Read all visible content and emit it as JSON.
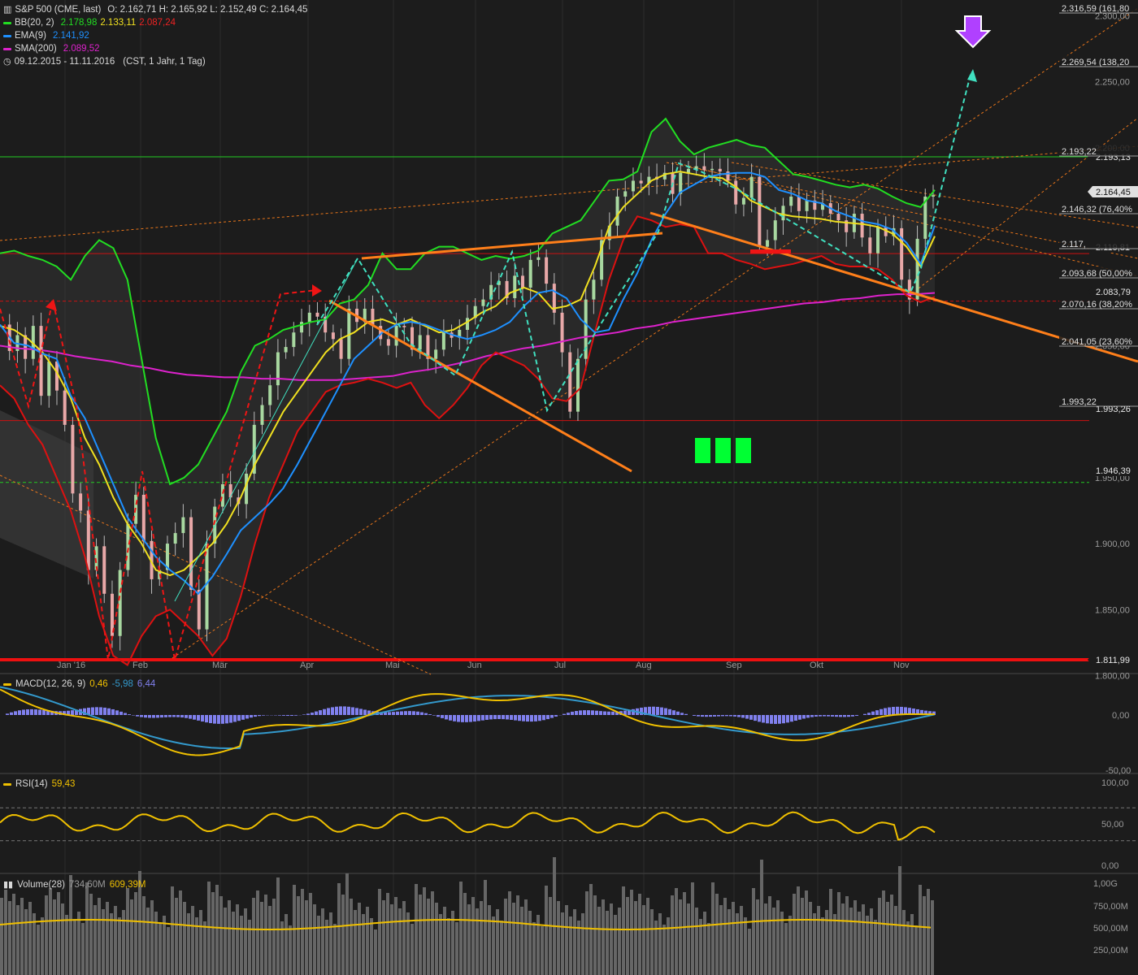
{
  "header": {
    "symbol": "S&P 500 (CME, last)",
    "ohlc": "O: 2.162,71  H: 2.165,92  L: 2.152,49  C: 2.164,45",
    "bb_label": "BB(20, 2)",
    "bb_values": [
      "2.178,98",
      "2.133,11",
      "2.087,24"
    ],
    "ema_label": "EMA(9)",
    "ema_value": "2.141,92",
    "sma_label": "SMA(200)",
    "sma_value": "2.089,52",
    "range": "09.12.2015 - 11.11.2016",
    "range_info": "(CST, 1 Jahr, 1 Tag)",
    "icons": [
      "bar-chart-icon",
      "clock-icon"
    ]
  },
  "colors": {
    "background": "#1c1c1c",
    "bb_upper": "#22dd22",
    "bb_mid": "#f0e020",
    "bb_lower": "#dd1111",
    "ema": "#1e90ff",
    "sma": "#dd22cc",
    "trend": "#ff7f1a",
    "pattern": "#40e0c0",
    "hline_red": "#cc1010",
    "hline_green": "#22cc22",
    "macd": "#f0c000",
    "signal": "#3399cc",
    "hist": "#8080ee",
    "rsi": "#f0c000",
    "volume": "#666666",
    "volume_ma": "#f0c000",
    "arrow_purple": "#b040ff",
    "marker_green": "#00ff33"
  },
  "chart_data": {
    "type": "candlestick",
    "x_axis_labels": [
      "Jan '16",
      "Feb",
      "Mär",
      "Apr",
      "Mai",
      "Jun",
      "Jul",
      "Aug",
      "Sep",
      "Okt",
      "Nov"
    ],
    "price_axis_ticks": [
      "2.300,00",
      "2.250,00",
      "2.200,00",
      "2.050,00",
      "1.950,00",
      "1.900,00",
      "1.850,00",
      "1.800,00"
    ],
    "price_levels": [
      {
        "label": "2.316,59 (161,80",
        "kind": "fib"
      },
      {
        "label": "2.269,54 (138,20",
        "kind": "fib"
      },
      {
        "label": "2.193,13",
        "kind": "box"
      },
      {
        "label": "2.193,22",
        "kind": "fib"
      },
      {
        "label": "2.164,45",
        "kind": "box-light"
      },
      {
        "label": "2.146,32 (76,40%",
        "kind": "fib"
      },
      {
        "label": "2.119,81",
        "kind": "box"
      },
      {
        "label": "2.117,",
        "kind": "fib"
      },
      {
        "label": "2.093,68 (50,00%",
        "kind": "fib"
      },
      {
        "label": "2.083,79",
        "kind": "box"
      },
      {
        "label": "2.070,16 (38,20%",
        "kind": "fib"
      },
      {
        "label": "2.041,05 (23,60%",
        "kind": "fib"
      },
      {
        "label": "1.993,26",
        "kind": "box"
      },
      {
        "label": "1.993,22",
        "kind": "fib"
      },
      {
        "label": "1.946,39",
        "kind": "box"
      },
      {
        "label": "1.811,99",
        "kind": "box"
      }
    ],
    "price_range": [
      1800,
      2320
    ],
    "close_path": [
      2066,
      2046,
      2058,
      2040,
      2065,
      2012,
      2038,
      2016,
      1990,
      1938,
      1925,
      1880,
      1898,
      1862,
      1830,
      1880,
      1915,
      1937,
      1902,
      1873,
      1880,
      1900,
      1908,
      1920,
      1865,
      1835,
      1900,
      1928,
      1945,
      1935,
      1930,
      1953,
      1990,
      2005,
      2020,
      2045,
      2049,
      2060,
      2068,
      2075,
      2072,
      2060,
      2055,
      2040,
      2078,
      2068,
      2078,
      2065,
      2055,
      2050,
      2065,
      2064,
      2047,
      2058,
      2040,
      2047,
      2060,
      2056,
      2062,
      2071,
      2080,
      2085,
      2096,
      2099,
      2086,
      2103,
      2094,
      2115,
      2117,
      2097,
      2075,
      2045,
      2000,
      2040,
      2085,
      2100,
      2130,
      2141,
      2163,
      2167,
      2175,
      2173,
      2178,
      2176,
      2181,
      2165,
      2181,
      2184,
      2186,
      2183,
      2184,
      2182,
      2175,
      2157,
      2162,
      2178,
      2125,
      2130,
      2145,
      2156,
      2163,
      2152,
      2160,
      2153,
      2158,
      2150,
      2145,
      2136,
      2150,
      2132,
      2120,
      2140,
      2133,
      2139,
      2100,
      2085,
      2131,
      2163,
      2164
    ],
    "bb_upper_path": [
      2120,
      2122,
      2118,
      2115,
      2110,
      2100,
      2118,
      2130,
      2124,
      2100,
      2040,
      1980,
      1945,
      1950,
      1960,
      1980,
      2000,
      2030,
      2050,
      2055,
      2062,
      2065,
      2068,
      2070,
      2082,
      2085,
      2096,
      2120,
      2108,
      2108,
      2120,
      2125,
      2125,
      2120,
      2115,
      2118,
      2116,
      2118,
      2122,
      2135,
      2140,
      2145,
      2160,
      2175,
      2176,
      2182,
      2212,
      2222,
      2205,
      2195,
      2200,
      2203,
      2206,
      2202,
      2200,
      2190,
      2180,
      2178,
      2175,
      2172,
      2170,
      2172,
      2169,
      2163,
      2158,
      2155,
      2168
    ],
    "bb_mid_path": [
      2065,
      2062,
      2055,
      2045,
      2030,
      2010,
      1980,
      1960,
      1935,
      1915,
      1900,
      1880,
      1876,
      1880,
      1890,
      1900,
      1915,
      1935,
      1960,
      1980,
      2000,
      2015,
      2030,
      2045,
      2055,
      2060,
      2068,
      2070,
      2066,
      2070,
      2065,
      2060,
      2062,
      2068,
      2075,
      2080,
      2090,
      2094,
      2090,
      2078,
      2080,
      2085,
      2110,
      2140,
      2155,
      2165,
      2175,
      2180,
      2182,
      2180,
      2178,
      2177,
      2170,
      2160,
      2155,
      2150,
      2148,
      2147,
      2146,
      2144,
      2143,
      2142,
      2140,
      2135,
      2125,
      2110,
      2133
    ],
    "bb_lower_path": [
      2020,
      2010,
      1990,
      1975,
      1950,
      1925,
      1890,
      1845,
      1815,
      1808,
      1830,
      1845,
      1850,
      1840,
      1830,
      1815,
      1828,
      1860,
      1900,
      1935,
      1960,
      1985,
      2000,
      2015,
      2020,
      2022,
      2025,
      2022,
      2018,
      2022,
      2005,
      1995,
      2005,
      2018,
      2035,
      2045,
      2040,
      2035,
      2025,
      2010,
      2008,
      2018,
      2060,
      2100,
      2130,
      2148,
      2145,
      2140,
      2142,
      2140,
      2120,
      2120,
      2115,
      2112,
      2108,
      2110,
      2112,
      2115,
      2118,
      2112,
      2110,
      2110,
      2108,
      2100,
      2088,
      2083,
      2087
    ],
    "ema_path": [
      2066,
      2052,
      2050,
      2044,
      2040,
      2012,
      1995,
      1970,
      1945,
      1920,
      1905,
      1890,
      1880,
      1872,
      1862,
      1875,
      1892,
      1910,
      1920,
      1930,
      1942,
      1960,
      1980,
      2000,
      2020,
      2040,
      2050,
      2060,
      2066,
      2068,
      2066,
      2062,
      2058,
      2055,
      2058,
      2062,
      2068,
      2080,
      2090,
      2092,
      2086,
      2070,
      2060,
      2062,
      2085,
      2105,
      2130,
      2150,
      2166,
      2172,
      2178,
      2180,
      2181,
      2181,
      2178,
      2168,
      2165,
      2160,
      2158,
      2152,
      2148,
      2144,
      2142,
      2138,
      2128,
      2112,
      2141
    ],
    "sma_path": [
      2050,
      2048,
      2047,
      2045,
      2042,
      2040,
      2038,
      2035,
      2033,
      2030,
      2028,
      2027,
      2026,
      2026,
      2025,
      2025,
      2024,
      2024,
      2024,
      2025,
      2026,
      2027,
      2030,
      2032,
      2035,
      2038,
      2042,
      2045,
      2048,
      2050,
      2053,
      2056,
      2058,
      2060,
      2063,
      2065,
      2068,
      2070,
      2072,
      2074,
      2076,
      2078,
      2080,
      2082,
      2083,
      2085,
      2086,
      2088,
      2089,
      2089,
      2090
    ],
    "macd": {
      "label": "MACD(12, 26, 9)",
      "values": [
        "0,46",
        "-5,98",
        "6,44"
      ],
      "ticks": [
        "0,00",
        "-50,00"
      ]
    },
    "rsi": {
      "label": "RSI(14)",
      "value": "59,43",
      "ticks": [
        "100,00",
        "50,00",
        "0,00"
      ],
      "levels": [
        70,
        30
      ]
    },
    "volume": {
      "label": "Volume(28)",
      "values": [
        "734,60M",
        "609,39M"
      ],
      "ticks": [
        "1,00G",
        "750,00M",
        "500,00M",
        "250,00M"
      ]
    }
  }
}
